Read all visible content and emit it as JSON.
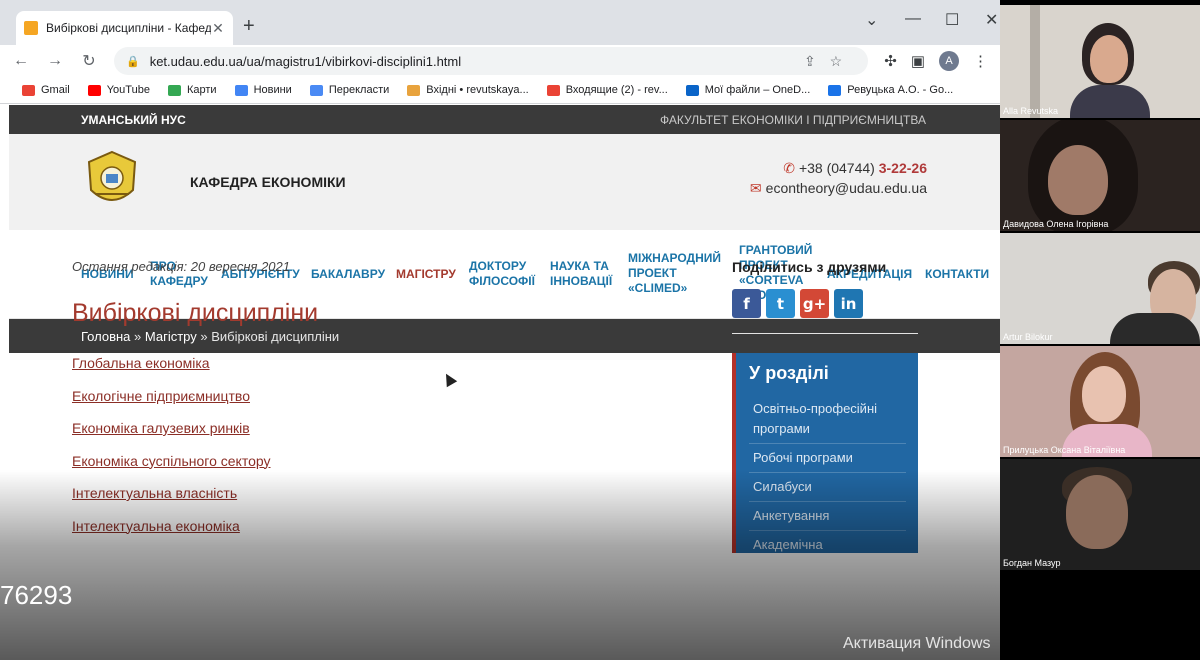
{
  "browser": {
    "tab_title": "Вибіркові дисципліни - Кафедра",
    "url": "ket.udau.edu.ua/ua/magistru1/vibirkovi-disciplini1.html",
    "profile_initial": "A",
    "bookmarks": [
      "Gmail",
      "YouTube",
      "Карти",
      "Новини",
      "Перекласти",
      "Вхідні • revutskaya...",
      "Входящие (2) - rev...",
      "Мої файли – OneD...",
      "Ревуцька А.О. - Go..."
    ]
  },
  "page": {
    "university": "УМАНСЬКИЙ НУС",
    "faculty": "ФАКУЛЬТЕТ ЕКОНОМІКИ І ПІДПРИЄМНИЦТВА",
    "department": "КАФЕДРА ЕКОНОМІКИ",
    "phone_prefix": "+38 (04744)",
    "phone_number": "3-22-26",
    "email": "econtheory@udau.edu.ua",
    "menu": [
      "НОВИНИ",
      "ПРО\nКАФЕДРУ",
      "АБІТУРІЄНТУ",
      "БАКАЛАВРУ",
      "МАГІСТРУ",
      "ДОКТОРУ\nФІЛОСОФІЇ",
      "НАУКА ТА\nІННОВАЦІЇ",
      "МІЖНАРОДНИЙ\nПРОЕКТ\n«CLIMED»",
      "ГРАНТОВИЙ\nПРОЕКТ\n«CORTEVA\nGROWS»",
      "АКРЕДИТАЦІЯ",
      "КОНТАКТИ"
    ],
    "breadcrumb": {
      "home": "Головна",
      "sep": " » ",
      "level2": "Магістру",
      "current": "Вибіркові дисципліни"
    },
    "last_edited": "Остання редакція: 20 вересня 2021",
    "heading": "Вибіркові дисципліни",
    "disciplines": [
      "Глобальна економіка",
      "Екологічне підприємництво",
      "Економіка галузевих ринків",
      "Економіка суспільного сектору",
      "Інтелектуальна власність",
      "Інтелектуальна економіка"
    ],
    "share_title": "Поділитись з друзями",
    "section_title": "У розділі",
    "section_items": [
      "Освітньо-професійні програми",
      "Робочі програми",
      "Силабуси",
      "Анкетування",
      "Академічна"
    ]
  },
  "overlay": {
    "number": "76293",
    "activation": "Активация Windows"
  },
  "participants": [
    "Alla Revutska",
    "Давидова Олена Ігорівна",
    "Artur Bilokur",
    "Прилуцька Оксана Віталіївна",
    "Богдан Мазур"
  ],
  "colors": {
    "accent_red": "#a33a2e",
    "menu_blue": "#1b74a7",
    "section_blue": "#2167a3",
    "dark_bar": "#3a3a3a"
  }
}
